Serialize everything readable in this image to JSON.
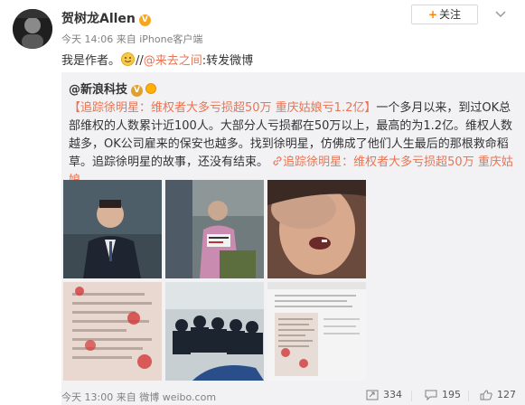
{
  "post": {
    "author": "贺树龙Allen",
    "time": "今天 14:06",
    "source_prefix": "来自",
    "source": "iPhone客户端",
    "follow_label": "关注",
    "text_before": "我是作者。",
    "text_slashes": "//",
    "mention": "@来去之间",
    "text_after": ":转发微博"
  },
  "repost": {
    "author": "@新浪科技",
    "body_link": "【追踪徐明星：维权者大多亏损超50万 重庆姑娘亏1.2亿】",
    "body": "一个多月以来，到过OK总部维权的人数累计近100人。大部分人亏损都在50万以上，最高的为1.2亿。维权人数越多，OK公司雇来的保安也越多。找到徐明星，仿佛成了他们人生最后的那根救命稻草。追踪徐明星的故事，还没有结束。",
    "link_text": "追踪徐明星：维权者大多亏损超50万 重庆姑娘..."
  },
  "footer": {
    "time": "今天 13:00",
    "source_prefix": "来自",
    "source": "微博 weibo.com",
    "repost_count": "334",
    "comment_count": "195",
    "like_count": "127"
  },
  "colors": {
    "accent": "#eb7350",
    "follow_plus": "#ff8200",
    "badge": "#f5a623",
    "repost_bg": "#f2f2f5"
  },
  "icons": {
    "verified": "verified-v-icon",
    "follow": "plus-icon",
    "menu": "chevron-down-icon",
    "link": "link-icon",
    "repost": "repost-icon",
    "comment": "comment-icon",
    "like": "thumbs-up-icon"
  }
}
